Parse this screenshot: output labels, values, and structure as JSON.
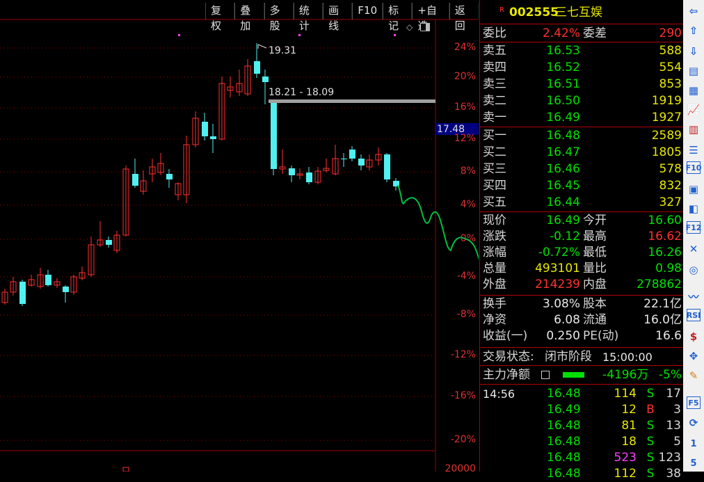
{
  "toolbar": [
    "复权",
    "叠加",
    "多股",
    "统计",
    "画线",
    "F10",
    "标记",
    "+自选",
    "返回"
  ],
  "chart": {
    "axis_labels": [
      "24%",
      "20%",
      "16%",
      "12%",
      "8%",
      "4%",
      "0%",
      "-4%",
      "-8%",
      "-12%",
      "-16%",
      "-20%"
    ],
    "axis_bottom": "20000",
    "price_marker": "17.48",
    "high_label": "19.31",
    "gap_label": "18.21 - 18.09"
  },
  "chart_data": {
    "type": "candlestick",
    "axis": [
      "24%",
      "20%",
      "16%",
      "12%",
      "8%",
      "4%",
      "0%",
      "-4%",
      "-8%",
      "-12%",
      "-16%",
      "-20%"
    ]
  },
  "stock": {
    "badge": "R",
    "code": "002555",
    "name": "三七互娱"
  },
  "weibi": {
    "label1": "委比",
    "value1": "2.42%",
    "label2": "委差",
    "value2": "290"
  },
  "asks": [
    {
      "label": "卖五",
      "price": "16.53",
      "vol": "588"
    },
    {
      "label": "卖四",
      "price": "16.52",
      "vol": "554"
    },
    {
      "label": "卖三",
      "price": "16.51",
      "vol": "853"
    },
    {
      "label": "卖二",
      "price": "16.50",
      "vol": "1919"
    },
    {
      "label": "卖一",
      "price": "16.49",
      "vol": "1927"
    }
  ],
  "bids": [
    {
      "label": "买一",
      "price": "16.48",
      "vol": "2589"
    },
    {
      "label": "买二",
      "price": "16.47",
      "vol": "1805"
    },
    {
      "label": "买三",
      "price": "16.46",
      "vol": "578"
    },
    {
      "label": "买四",
      "price": "16.45",
      "vol": "832"
    },
    {
      "label": "买五",
      "price": "16.44",
      "vol": "327"
    }
  ],
  "quote": [
    {
      "l1": "现价",
      "v1": "16.49",
      "l2": "今开",
      "v2": "16.60"
    },
    {
      "l1": "涨跌",
      "v1": "-0.12",
      "l2": "最高",
      "v2": "16.62"
    },
    {
      "l1": "涨幅",
      "v1": "-0.72%",
      "l2": "最低",
      "v2": "16.26"
    },
    {
      "l1": "总量",
      "v1": "493101",
      "l2": "量比",
      "v2": "0.98"
    },
    {
      "l1": "外盘",
      "v1": "214239",
      "l2": "内盘",
      "v2": "278862"
    }
  ],
  "fund": [
    {
      "l1": "换手",
      "v1": "3.08%",
      "l2": "股本",
      "v2": "22.1亿"
    },
    {
      "l1": "净资",
      "v1": "6.08",
      "l2": "流通",
      "v2": "16.0亿"
    },
    {
      "l1": "收益(一)",
      "v1": "0.250",
      "l2": "PE(动)",
      "v2": "16.6"
    }
  ],
  "status": {
    "label": "交易状态:",
    "value": "闭市阶段",
    "time": "15:00:00"
  },
  "mainforce": {
    "label": "主力净额",
    "value": "-4196万",
    "pct": "-5%"
  },
  "ticks": [
    {
      "time": "14:56",
      "price": "16.48",
      "vol": "114",
      "side": "S",
      "n": "17"
    },
    {
      "time": "",
      "price": "16.49",
      "vol": "12",
      "side": "B",
      "n": "3"
    },
    {
      "time": "",
      "price": "16.48",
      "vol": "81",
      "side": "S",
      "n": "13"
    },
    {
      "time": "",
      "price": "16.48",
      "vol": "18",
      "side": "S",
      "n": "5"
    },
    {
      "time": "",
      "price": "16.48",
      "vol": "523",
      "side": "S",
      "n": "123"
    },
    {
      "time": "",
      "price": "16.48",
      "vol": "112",
      "side": "S",
      "n": "38"
    }
  ],
  "sidebar_icons": [
    "arrow-left-icon",
    "arrow-up-icon",
    "arrow-down-icon",
    "report-icon",
    "table-icon",
    "line-chart-icon",
    "candle-chart-icon",
    "list-icon",
    "f10-icon",
    "news-icon",
    "self-select-icon",
    "f12-icon",
    "tx-icon",
    "circle-icon",
    "trend-icon",
    "rsi-icon",
    "money-icon",
    "move-icon",
    "pen-icon",
    "f5-icon",
    "refresh-icon",
    "one-icon",
    "five-icon"
  ],
  "sidebar_text": {
    "f10": "F10",
    "f12": "F12",
    "rsi": "RSI",
    "f5": "F5",
    "one": "1",
    "five": "5"
  }
}
